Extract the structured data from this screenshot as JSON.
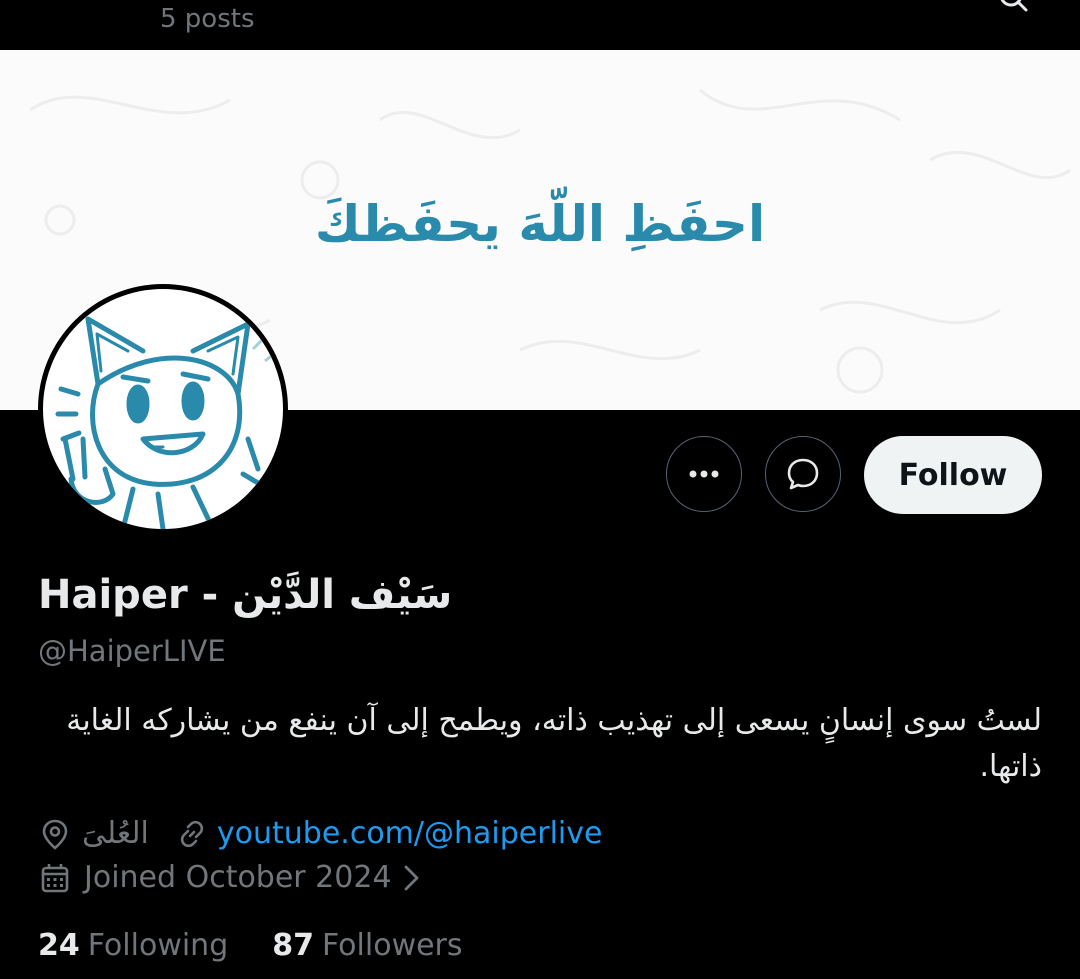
{
  "header": {
    "post_count": "5 posts",
    "search_icon": "search-icon"
  },
  "banner": {
    "text": "احفَظِ اللّهَ يحفَظكَ",
    "text_color": "#2a8aab",
    "background": "#fbfbfb"
  },
  "avatar": {
    "description_icon": "cartoon-cat-avatar",
    "line_color": "#2a8aab"
  },
  "actions": {
    "more_icon": "more-icon",
    "message_icon": "message-icon",
    "follow_label": "Follow"
  },
  "profile": {
    "display_name": "Haiper - سَيْف الدَّيْن",
    "handle": "@HaiperLIVE",
    "bio": "لستُ سوى إنسانٍ يسعى إلى تهذيب ذاته، ويطمح إلى آن ينفع من يشاركه الغاية ذاتها.",
    "location": "العُلىَ",
    "link": "youtube.com/@haiperlive",
    "joined": "Joined October 2024"
  },
  "stats": {
    "following_count": "24",
    "following_label": "Following",
    "followers_count": "87",
    "followers_label": "Followers"
  },
  "colors": {
    "background": "#000000",
    "primary_text": "#e7e9ea",
    "secondary_text": "#71767b",
    "link": "#1d9bf0",
    "follow_button_bg": "#eff3f4"
  }
}
